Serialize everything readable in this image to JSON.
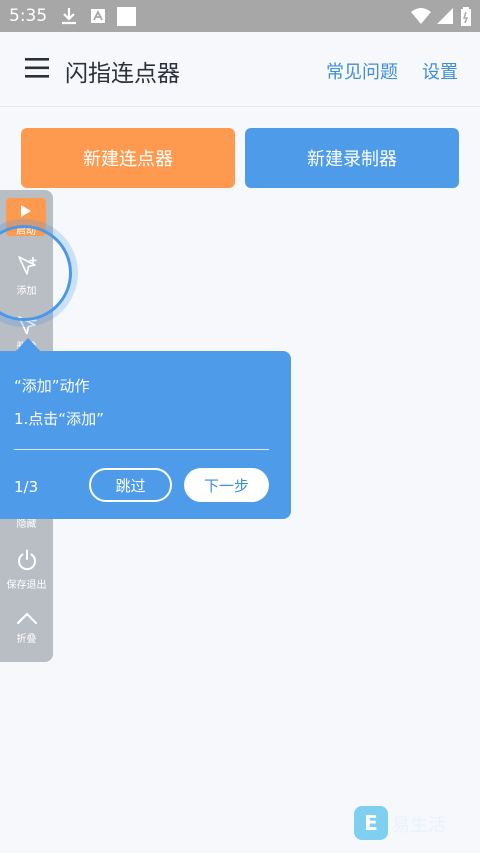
{
  "status_bar": {
    "time": "5:35",
    "icons": [
      "download-icon",
      "a-icon",
      "square-icon",
      "wifi-icon",
      "signal-icon",
      "battery-icon"
    ]
  },
  "app_bar": {
    "title": "闪指连点器",
    "faq": "常见问题",
    "settings": "设置"
  },
  "actions": {
    "new_clicker": "新建连点器",
    "new_recorder": "新建录制器"
  },
  "toolbar": {
    "start": "启动",
    "add": "添加",
    "remove": "删除",
    "hide": "隐藏",
    "save_exit": "保存退出",
    "collapse": "折叠"
  },
  "tooltip": {
    "title": "“添加”动作",
    "step": "1.点击“添加”",
    "counter": "1/3",
    "skip": "跳过",
    "next": "下一步"
  },
  "watermark": {
    "logo_letter": "E",
    "text": "易生活"
  },
  "colors": {
    "orange": "#fe9a4f",
    "blue": "#4e9bea",
    "link_blue": "#3f8fdc",
    "toolbar_gray": "#b9bdc4"
  }
}
